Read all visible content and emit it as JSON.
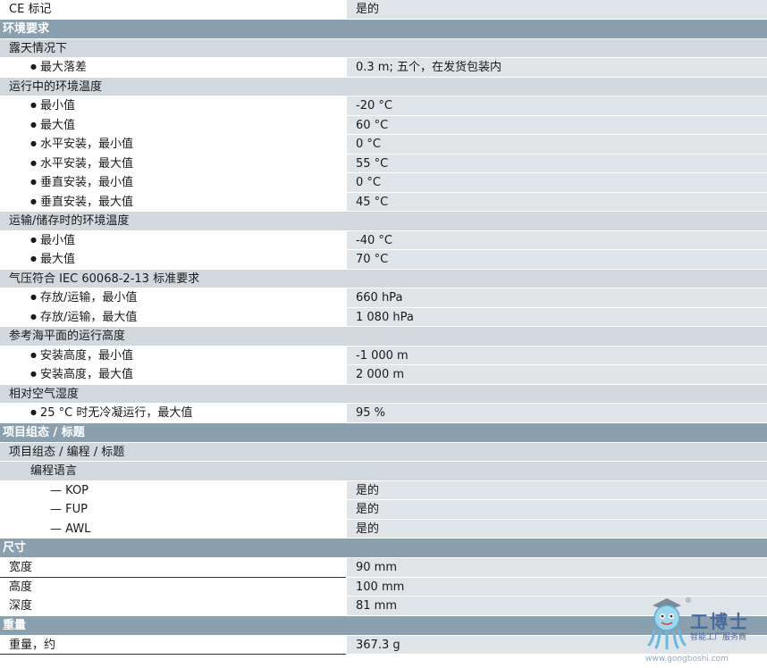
{
  "rows": [
    {
      "t": "data",
      "lvl": 0,
      "label": "CE 标记",
      "value": "是的",
      "h": 21
    },
    {
      "t": "section",
      "label": "环境要求"
    },
    {
      "t": "sub",
      "lvl": 0,
      "label": "露天情况下"
    },
    {
      "t": "data",
      "lvl": 1,
      "label": "最大落差",
      "value": "0.3 m; 五个，在发货包装内"
    },
    {
      "t": "sub",
      "lvl": 0,
      "label": "运行中的环境温度"
    },
    {
      "t": "data",
      "lvl": 1,
      "label": "最小值",
      "value": "-20 °C"
    },
    {
      "t": "data",
      "lvl": 1,
      "label": "最大值",
      "value": "60 °C"
    },
    {
      "t": "data",
      "lvl": 1,
      "label": "水平安装，最小值",
      "value": "0 °C"
    },
    {
      "t": "data",
      "lvl": 1,
      "label": "水平安装，最大值",
      "value": "55 °C"
    },
    {
      "t": "data",
      "lvl": 1,
      "label": "垂直安装，最小值",
      "value": "0 °C"
    },
    {
      "t": "data",
      "lvl": 1,
      "label": "垂直安装，最大值",
      "value": "45 °C"
    },
    {
      "t": "sub",
      "lvl": 0,
      "label": "运输/储存时的环境温度"
    },
    {
      "t": "data",
      "lvl": 1,
      "label": "最小值",
      "value": "-40 °C"
    },
    {
      "t": "data",
      "lvl": 1,
      "label": "最大值",
      "value": "70 °C"
    },
    {
      "t": "sub",
      "lvl": 0,
      "label": "气压符合 IEC 60068-2-13 标准要求"
    },
    {
      "t": "data",
      "lvl": 1,
      "label": "存放/运输，最小值",
      "value": "660 hPa"
    },
    {
      "t": "data",
      "lvl": 1,
      "label": "存放/运输，最大值",
      "value": "1 080 hPa"
    },
    {
      "t": "sub",
      "lvl": 0,
      "label": "参考海平面的运行高度"
    },
    {
      "t": "data",
      "lvl": 1,
      "label": "安装高度，最小值",
      "value": "-1 000 m"
    },
    {
      "t": "data",
      "lvl": 1,
      "label": "安装高度，最大值",
      "value": "2 000 m"
    },
    {
      "t": "sub",
      "lvl": 0,
      "label": "相对空气湿度"
    },
    {
      "t": "data",
      "lvl": 1,
      "label": "25 °C 时无冷凝运行，最大值",
      "value": "95 %"
    },
    {
      "t": "section",
      "label": "项目组态 / 标题"
    },
    {
      "t": "sub",
      "lvl": 0,
      "label": "项目组态 / 编程 / 标题"
    },
    {
      "t": "sub",
      "lvl": 1,
      "label": "编程语言"
    },
    {
      "t": "data",
      "lvl": 2,
      "label": "— KOP",
      "value": "是的"
    },
    {
      "t": "data",
      "lvl": 2,
      "label": "— FUP",
      "value": "是的"
    },
    {
      "t": "data",
      "lvl": 2,
      "label": "— AWL",
      "value": "是的"
    },
    {
      "t": "section",
      "label": "尺寸"
    },
    {
      "t": "data",
      "lvl": 0,
      "label": "宽度",
      "value": "90 mm",
      "bl": true
    },
    {
      "t": "data",
      "lvl": 0,
      "label": "高度",
      "value": "100 mm"
    },
    {
      "t": "data",
      "lvl": 0,
      "label": "深度",
      "value": "81 mm"
    },
    {
      "t": "section",
      "label": "重量"
    },
    {
      "t": "data",
      "lvl": 0,
      "label": "重量，约",
      "value": "367.3 g",
      "bl": true
    }
  ],
  "watermark": {
    "name": "工博士",
    "tagline": "智能工厂服务商",
    "url": "www.gongboshi.com",
    "reg": "®"
  }
}
